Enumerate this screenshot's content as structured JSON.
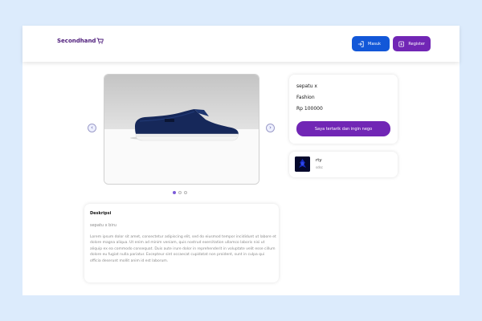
{
  "navbar": {
    "logo_text": "Secondhand",
    "login_label": "Masuk",
    "register_label": "Register"
  },
  "carousel": {
    "slides_count": 3,
    "active_index": 0
  },
  "product": {
    "name": "sepatu x",
    "category": "Fashion",
    "price": "Rp 100000",
    "nego_label": "Saya tertarik dan ingin nego"
  },
  "seller": {
    "name": "rty",
    "city": "sdsc"
  },
  "description": {
    "title": "Deskripsi",
    "subtitle": "sepatu x biru",
    "body": "Lorem ipsum dolor sit amet, consectetur adipiscing elit, sed do eiusmod tempor incididunt ut labore et dolore magna aliqua. Ut enim ad minim veniam, quis nostrud exercitation ullamco laboris nisi ut aliquip ex ea commodo consequat. Duis aute irure dolor in reprehenderit in voluptate velit esse cillum dolore eu fugiat nulla pariatur. Excepteur sint occaecat cupidatat non proident, sunt in culpa qui officia deserunt mollit anim id est laborum."
  },
  "colors": {
    "brand_purple": "#7126b5",
    "login_blue": "#1257d8",
    "background": "#dcebfc"
  }
}
